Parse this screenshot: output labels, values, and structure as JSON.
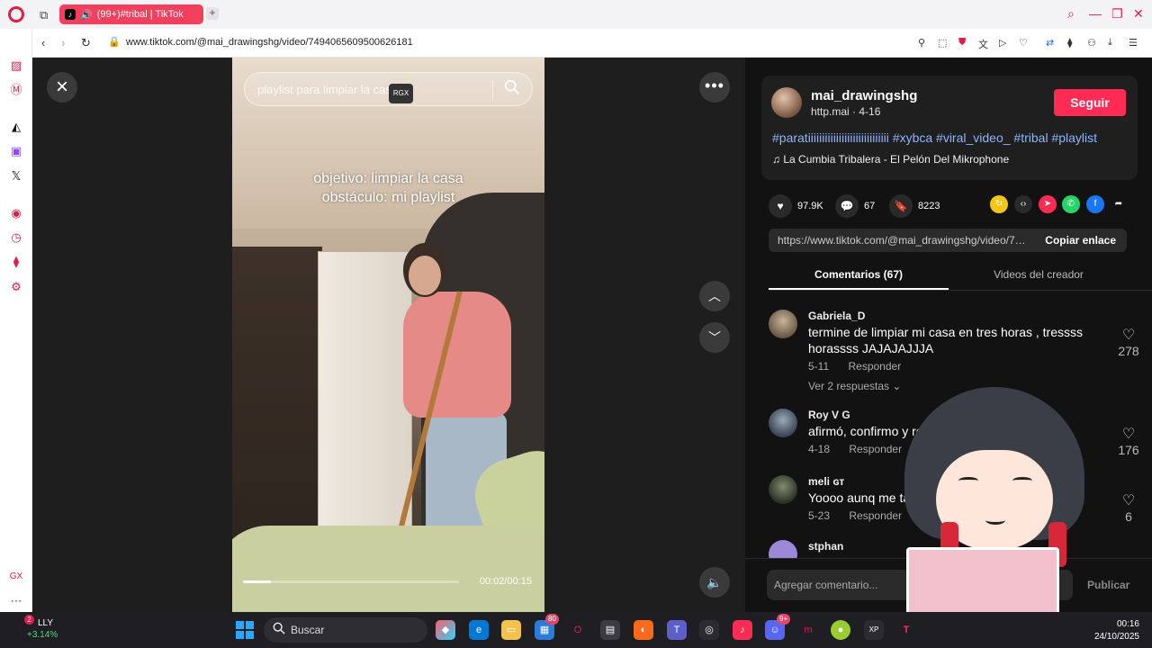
{
  "browser": {
    "tab_title": "(99+)#tribal | TikTok",
    "url": "www.tiktok.com/@mai_drawingshg/video/7494065609500626181"
  },
  "video": {
    "search_text": "playlist para limpiar la casa",
    "badge": "RGX",
    "caption_line1": "objetivo: limpiar la casa",
    "caption_line2": "obstáculo: mi playlist",
    "time": "00:02/00:15",
    "progress": 0.13
  },
  "post": {
    "username": "mai_drawingshg",
    "meta": "http.mai · 4-16",
    "follow_label": "Seguir",
    "hashtags": "#paratiiiiiiiiiiiiiiiiiiiiiiiiiiiii #xybca #viral_video_ #tribal #playlist",
    "music": "La Cumbia Tribalera - El Pelón Del Mikrophone",
    "likes": "97.9K",
    "comments": "67",
    "saves": "8223",
    "link": "https://www.tiktok.com/@mai_drawingshg/video/7494065609500626181",
    "copy_label": "Copiar enlace"
  },
  "tabs": {
    "comments": "Comentarios (67)",
    "videos": "Videos del creador"
  },
  "comments": [
    {
      "name": "Gabriela_D",
      "text": "termine de limpiar mi casa en tres horas , tressss horassss JAJAJAJJJA",
      "date": "5-11",
      "reply": "Responder",
      "likes": "278",
      "more": "Ver 2 respuestas ⌄"
    },
    {
      "name": "Roy V G",
      "text": "afirmó, confirmo y rea",
      "date": "4-18",
      "reply": "Responder",
      "likes": "176"
    },
    {
      "name": "meli ɢᴛ",
      "text": "Yoooo aunq me tardé",
      "date": "5-23",
      "reply": "Responder",
      "likes": "6"
    },
    {
      "name": "stphan"
    }
  ],
  "comment_input": {
    "placeholder": "Agregar comentario...",
    "publish": "Publicar"
  },
  "taskbar": {
    "stock_name": "LLY",
    "stock_change": "+3.14%",
    "stock_badge": "2",
    "search": "Buscar",
    "time": "00:16",
    "date": "24/10/2025",
    "badge_store": "80",
    "badge_discord": "9+"
  },
  "colors": {
    "accent": "#fe2c55",
    "opera": "#e11d48",
    "hashtag": "#8fb4ff"
  }
}
